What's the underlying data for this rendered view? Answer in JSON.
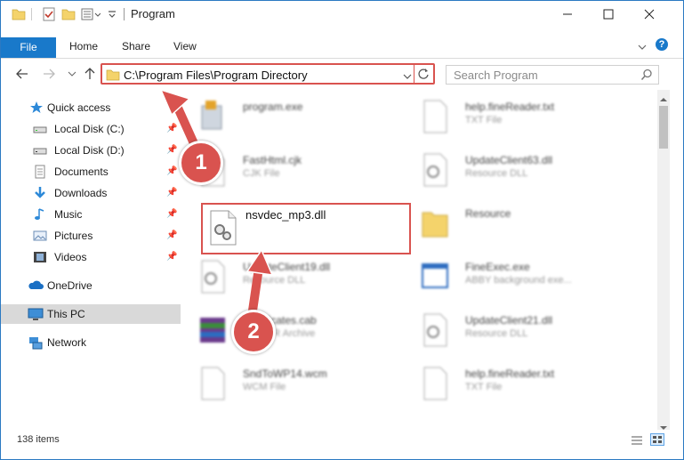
{
  "window": {
    "title": "Program"
  },
  "ribbon": {
    "tabs": [
      "File",
      "Home",
      "Share",
      "View"
    ]
  },
  "address": {
    "path": "C:\\Program Files\\Program Directory",
    "search_placeholder": "Search Program"
  },
  "sidebar": {
    "items": [
      {
        "label": "Quick access",
        "icon": "star-icon"
      },
      {
        "label": "Local Disk (C:)",
        "icon": "drive-icon",
        "pinned": true
      },
      {
        "label": "Local Disk (D:)",
        "icon": "drive-icon",
        "pinned": true
      },
      {
        "label": "Documents",
        "icon": "documents-icon",
        "pinned": true
      },
      {
        "label": "Downloads",
        "icon": "download-icon",
        "pinned": true
      },
      {
        "label": "Music",
        "icon": "music-icon",
        "pinned": true
      },
      {
        "label": "Pictures",
        "icon": "pictures-icon",
        "pinned": true
      },
      {
        "label": "Videos",
        "icon": "videos-icon",
        "pinned": true
      },
      {
        "label": "OneDrive",
        "icon": "cloud-icon"
      },
      {
        "label": "This PC",
        "icon": "computer-icon",
        "selected": true
      },
      {
        "label": "Network",
        "icon": "network-icon"
      }
    ]
  },
  "files": {
    "left": [
      {
        "name": "program.exe",
        "type": ""
      },
      {
        "name": "FastHtml.cjk",
        "type": "CJK File"
      },
      {
        "name": "nsvdec_mp3.dll",
        "type": ""
      },
      {
        "name": "UpdateClient19.dll",
        "type": "Resource DLL"
      },
      {
        "name": "Certificates.cab",
        "type": "WinRAR Archive"
      },
      {
        "name": "SndToWP14.wcm",
        "type": "WCM File"
      }
    ],
    "right": [
      {
        "name": "help.fineReader.txt",
        "type": "TXT File"
      },
      {
        "name": "UpdateClient63.dll",
        "type": "Resource DLL"
      },
      {
        "name": "Resource",
        "type": ""
      },
      {
        "name": "FineExec.exe",
        "type": "ABBY background exe..."
      },
      {
        "name": "UpdateClient21.dll",
        "type": "Resource DLL"
      },
      {
        "name": "help.fineReader.txt",
        "type": "TXT File"
      }
    ]
  },
  "annotations": {
    "step1": "1",
    "step2": "2",
    "color": "#d9534f"
  },
  "status": {
    "items": "138 items"
  }
}
